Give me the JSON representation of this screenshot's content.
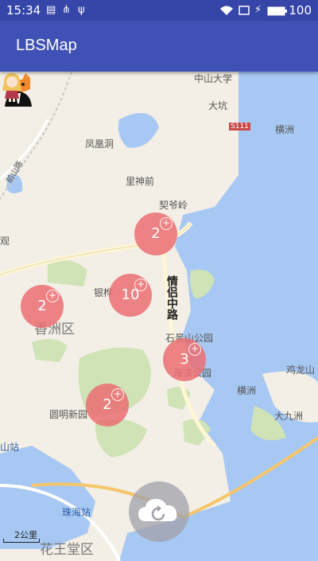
{
  "status_bar": {
    "time": "15:34",
    "battery": "100"
  },
  "app_bar": {
    "title": "LBSMap"
  },
  "map": {
    "places": {
      "zhongshan_univ": "中山大学",
      "dakeng": "大坑",
      "s111": "S111",
      "hengzhou": "横洲",
      "fenghuangdong": "凤凰洞",
      "lishenqian": "里神前",
      "qiyeling": "契爷岭",
      "yinhua": "银桦",
      "xiangzhou_district": "香洲区",
      "qinglv_road": "情侣中路",
      "shijingshan_park": "石景山公园",
      "xiangzhou_park": "海滨公园",
      "hengzhou2": "横洲",
      "jilongshan": "鸡龙山",
      "dajiuzhou": "大九洲",
      "yuanmingxinyuan": "圆明新园",
      "shan_station": "山站",
      "zhuhai_station": "珠海站",
      "huawangtang": "花王堂区",
      "left_edge": "观",
      "upper_left_road": "前山路"
    },
    "clusters": [
      {
        "id": "c1",
        "count": "2"
      },
      {
        "id": "c2",
        "count": "10"
      },
      {
        "id": "c3",
        "count": "2"
      },
      {
        "id": "c4",
        "count": "3"
      },
      {
        "id": "c5",
        "count": "2"
      }
    ],
    "scale_label": "2公里"
  },
  "colors": {
    "primary": "#3f51b5",
    "primary_dark": "#3646a8",
    "cluster": "#eb6e73",
    "sea": "#a7c8f2",
    "land": "#f3efe6",
    "green": "#cfe3b7"
  }
}
